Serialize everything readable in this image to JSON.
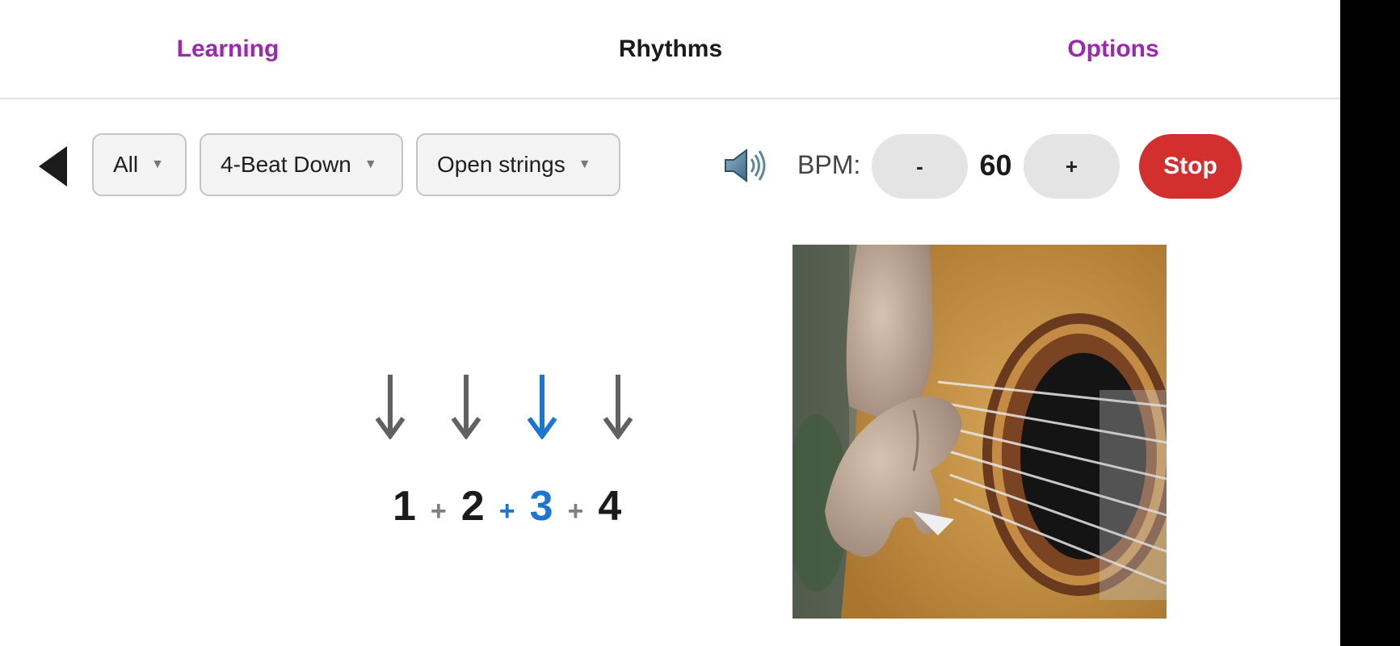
{
  "tabs": [
    {
      "label": "Learning",
      "color": "#9c27b0"
    },
    {
      "label": "Rhythms",
      "color": "#1b1b1b"
    },
    {
      "label": "Options",
      "color": "#9c27b0"
    }
  ],
  "controls": {
    "back_icon": "back-triangle-icon",
    "dropdowns": [
      {
        "value": "All"
      },
      {
        "value": "4-Beat Down"
      },
      {
        "value": "Open strings"
      }
    ],
    "caret": "▼",
    "speaker_icon": "speaker-icon",
    "bpm_label": "BPM:",
    "minus_label": "-",
    "bpm_value": "60",
    "plus_label": "+",
    "stop_label": "Stop",
    "stop_color": "#d32f2f"
  },
  "pattern": {
    "strums": [
      "down",
      "down",
      "down",
      "down"
    ],
    "active_strum_index": 2,
    "arrow_color": "#616161",
    "active_color": "#1976d2",
    "count": [
      "1",
      "+",
      "2",
      "+",
      "3",
      "+",
      "4"
    ],
    "active_count_indices": [
      3,
      4
    ]
  },
  "photo": {
    "icon": "guitar-strumming-photo"
  }
}
